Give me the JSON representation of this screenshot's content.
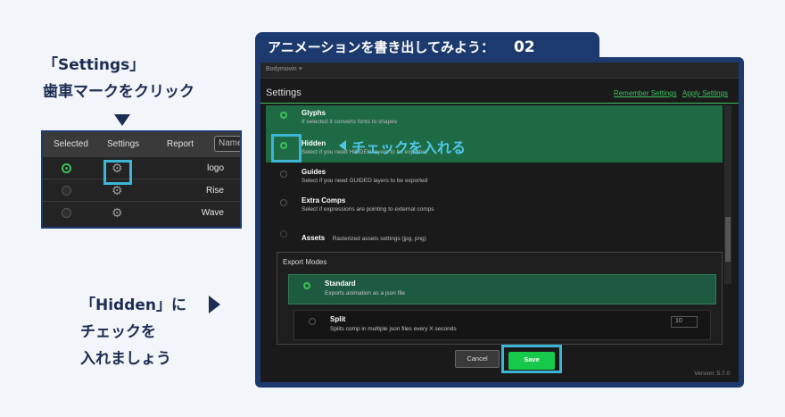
{
  "note_settings": {
    "line1": "「Settings」",
    "line2": "歯車マークをクリック"
  },
  "note_hidden": {
    "line1": "「Hidden」に",
    "line2": "チェックを",
    "line3": "入れましょう"
  },
  "mini_panel": {
    "headers": [
      "Selected",
      "Settings",
      "Report"
    ],
    "name_placeholder": "Name",
    "rows": [
      {
        "name": "logo",
        "selected": true
      },
      {
        "name": "Rise",
        "selected": false
      },
      {
        "name": "Wave",
        "selected": false
      }
    ]
  },
  "main_title": {
    "text": "アニメーションを書き出してみよう：",
    "num": "02"
  },
  "app": {
    "topbar": "Bodymovin  ≡",
    "settings_title": "Settings",
    "links": {
      "remember": "Remember Settings",
      "apply": "Apply Settings"
    },
    "items": [
      {
        "title": "Glyphs",
        "desc": "If selected it converts fonts to shapes"
      },
      {
        "title": "Hidden",
        "desc": "Select if you need HIDDEN layers to be exported"
      },
      {
        "title": "Guides",
        "desc": "Select if you need GUIDED layers to be exported"
      },
      {
        "title": "Extra Comps",
        "desc": "Select if expressions are pointing to external comps"
      },
      {
        "title": "Assets",
        "desc": "Rasterized assets settings (jpg, png)"
      }
    ],
    "callout": "チェックを入れる",
    "export": {
      "header": "Export Modes",
      "standard": {
        "title": "Standard",
        "desc": "Exports animation as a json file"
      },
      "split": {
        "title": "Split",
        "desc": "Splits comp in multiple json files every X seconds",
        "value": "10"
      }
    },
    "cancel_label": "Cancel",
    "save_label": "Save",
    "version": "Version: 5.7.0"
  },
  "colors": {
    "navy": "#1d3a6e",
    "accent_cyan": "#3cb6d6",
    "green": "#3cc25f"
  }
}
